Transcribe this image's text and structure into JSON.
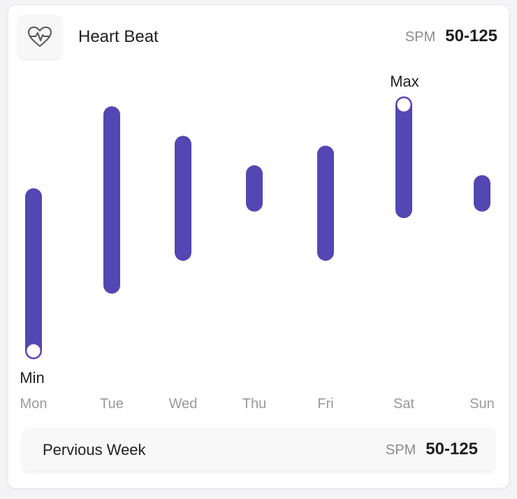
{
  "header": {
    "title": "Heart Beat",
    "unit": "SPM",
    "range": "50-125",
    "icon": "heart-pulse-icon"
  },
  "footer": {
    "label": "Pervious Week",
    "unit": "SPM",
    "range": "50-125"
  },
  "chart_data": {
    "type": "range-bar",
    "categories": [
      "Mon",
      "Tue",
      "Wed",
      "Thu",
      "Fri",
      "Sat",
      "Sun"
    ],
    "low": [
      50,
      70,
      80,
      95,
      80,
      93,
      95
    ],
    "high": [
      97,
      122,
      113,
      104,
      110,
      125,
      101
    ],
    "ylim": [
      50,
      125
    ],
    "min_label": "Min",
    "max_label": "Max",
    "min_category": "Mon",
    "max_category": "Sat",
    "bar_color": "#5446b3"
  }
}
